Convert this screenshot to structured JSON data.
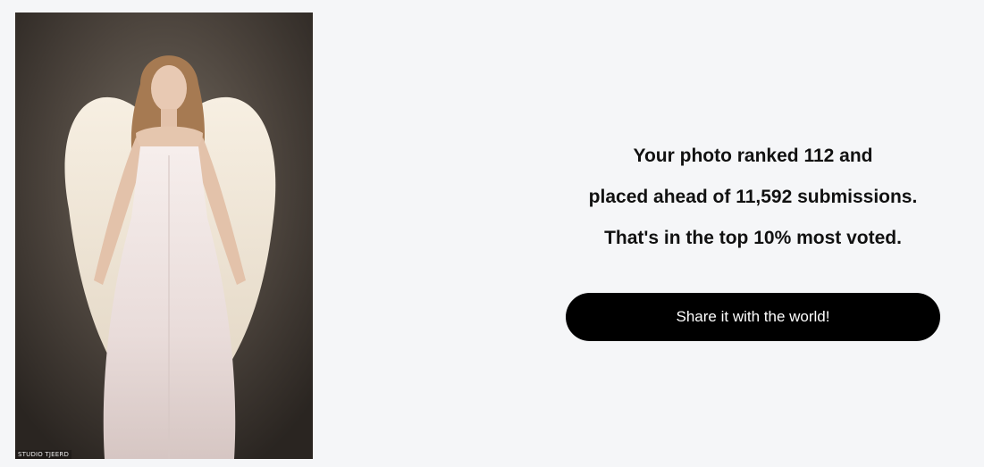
{
  "photo": {
    "alt": "angel-photo",
    "watermark": "STUDIO TJEERD"
  },
  "result": {
    "line1": "Your photo ranked 112 and",
    "line2": "placed ahead of 11,592 submissions.",
    "line3": "That's in the top 10% most voted."
  },
  "share": {
    "label": "Share it with the world!"
  },
  "colors": {
    "background": "#f5f6f8",
    "button": "#000000",
    "button_text": "#ffffff",
    "text": "#111111"
  }
}
